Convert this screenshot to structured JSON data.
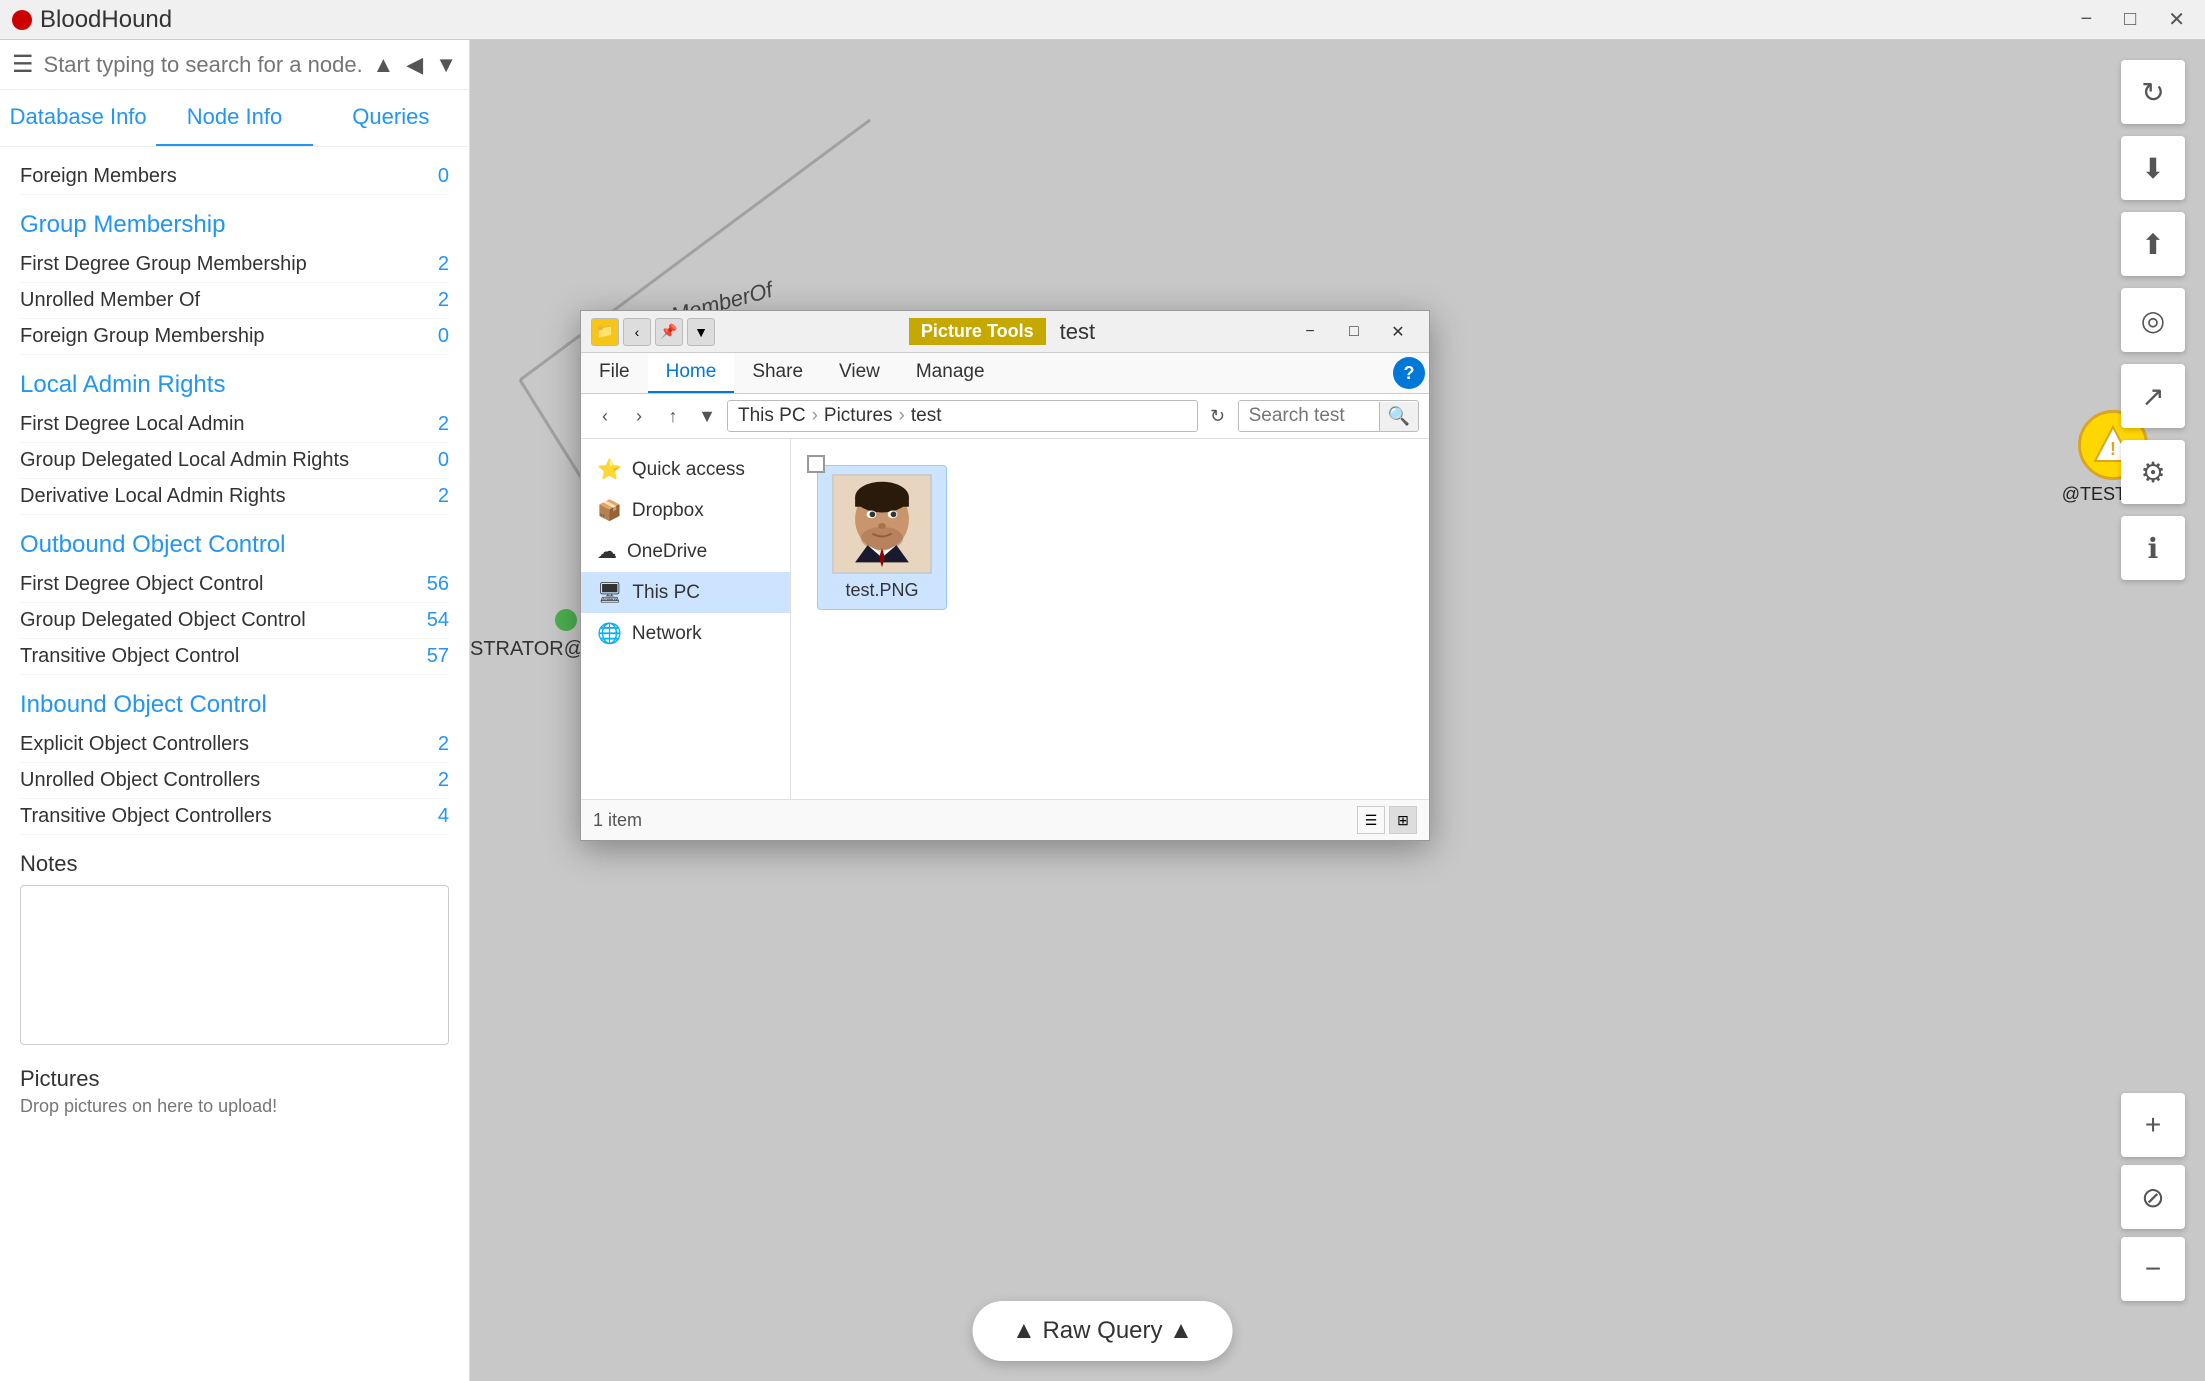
{
  "app": {
    "title": "BloodHound",
    "icon": "🩸"
  },
  "titlebar": {
    "minimize": "−",
    "maximize": "□",
    "close": "✕"
  },
  "sidebar": {
    "search_placeholder": "Start typing to search for a node...",
    "tabs": [
      {
        "id": "database-info",
        "label": "Database Info"
      },
      {
        "id": "node-info",
        "label": "Node Info"
      },
      {
        "id": "queries",
        "label": "Queries"
      }
    ],
    "active_tab": "node-info",
    "sections": {
      "foreign_members": {
        "label": "Foreign Members",
        "rows": [
          {
            "label": "Foreign Members",
            "count": "0"
          }
        ]
      },
      "group_membership": {
        "label": "Group Membership",
        "rows": [
          {
            "label": "First Degree Group Membership",
            "count": "2"
          },
          {
            "label": "Unrolled Member Of",
            "count": "2"
          },
          {
            "label": "Foreign Group Membership",
            "count": "0"
          }
        ]
      },
      "local_admin_rights": {
        "label": "Local Admin Rights",
        "rows": [
          {
            "label": "First Degree Local Admin",
            "count": "2"
          },
          {
            "label": "Group Delegated Local Admin Rights",
            "count": "0"
          },
          {
            "label": "Derivative Local Admin Rights",
            "count": "2"
          }
        ]
      },
      "outbound_object_control": {
        "label": "Outbound Object Control",
        "rows": [
          {
            "label": "First Degree Object Control",
            "count": "56"
          },
          {
            "label": "Group Delegated Object Control",
            "count": "54"
          },
          {
            "label": "Transitive Object Control",
            "count": "57"
          }
        ]
      },
      "inbound_object_control": {
        "label": "Inbound Object Control",
        "rows": [
          {
            "label": "Explicit Object Controllers",
            "count": "2"
          },
          {
            "label": "Unrolled Object Controllers",
            "count": "2"
          },
          {
            "label": "Transitive Object Controllers",
            "count": "4"
          }
        ]
      }
    },
    "notes_label": "Notes",
    "notes_placeholder": "",
    "pictures_label": "Pictures",
    "pictures_drop": "Drop pictures on here to upload!"
  },
  "graph": {
    "memberof_label": "MemberOf"
  },
  "toolbar": {
    "buttons": [
      {
        "id": "refresh",
        "icon": "↻"
      },
      {
        "id": "download-db",
        "icon": "⬇"
      },
      {
        "id": "upload-db",
        "icon": "⬆"
      },
      {
        "id": "target",
        "icon": "◎"
      },
      {
        "id": "chart",
        "icon": "↗"
      },
      {
        "id": "settings",
        "icon": "⚙"
      },
      {
        "id": "info",
        "icon": "ℹ"
      }
    ]
  },
  "zoom": {
    "plus": "+",
    "lock": "⊘",
    "minus": "−"
  },
  "raw_query": {
    "label": "▲ Raw Query ▲"
  },
  "node": {
    "label": "@TESTLAB.",
    "full_label": "STRATOR@TESTLAB.LOCAL"
  },
  "explorer": {
    "title": "test",
    "picture_tools_label": "Picture Tools",
    "ribbon_tabs": [
      {
        "id": "file",
        "label": "File"
      },
      {
        "id": "home",
        "label": "Home"
      },
      {
        "id": "share",
        "label": "Share"
      },
      {
        "id": "view",
        "label": "View"
      },
      {
        "id": "manage",
        "label": "Manage"
      }
    ],
    "active_ribbon_tab": "home",
    "address": {
      "this_pc": "This PC",
      "pictures": "Pictures",
      "test": "test"
    },
    "search_placeholder": "Search test",
    "sidebar_items": [
      {
        "id": "quick-access",
        "label": "Quick access",
        "icon": "⭐"
      },
      {
        "id": "dropbox",
        "label": "Dropbox",
        "icon": "📦"
      },
      {
        "id": "onedrive",
        "label": "OneDrive",
        "icon": "☁"
      },
      {
        "id": "this-pc",
        "label": "This PC",
        "icon": "🖥",
        "active": true
      },
      {
        "id": "network",
        "label": "Network",
        "icon": "🌐"
      }
    ],
    "file": {
      "name": "test.PNG",
      "type": "image"
    },
    "item_count": "1 item",
    "minimize": "−",
    "maximize": "□",
    "close": "✕"
  },
  "status": {
    "node_label": "STRATOR@TESTLAB.LOCAL",
    "indicator_color": "#4CAF50"
  }
}
